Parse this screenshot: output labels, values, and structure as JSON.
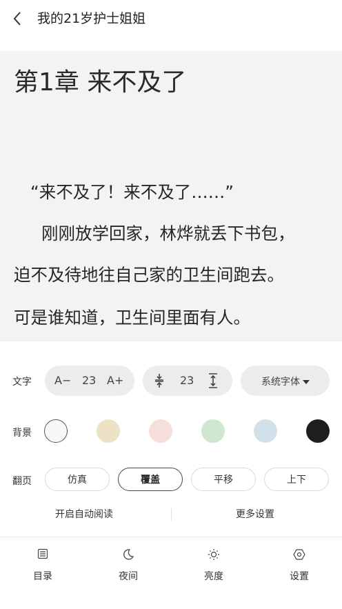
{
  "header": {
    "back_icon": "chevron-left-icon",
    "title": "我的21岁护士姐姐"
  },
  "reader": {
    "chapter_title": "第1章 来不及了",
    "paragraphs": [
      "“来不及了！来不及了……”",
      "刚刚放学回家，林烨就丢下书包，",
      "迫不及待地往自己家的卫生间跑去。",
      "可是谁知道，卫生间里面有人。"
    ]
  },
  "settings": {
    "text": {
      "label": "文字",
      "decrease": "A−",
      "font_size": "23",
      "increase": "A+",
      "line_spacing": "23",
      "font_family": "系统字体"
    },
    "background": {
      "label": "背景",
      "colors": [
        "#f7f7f9",
        "#ede1c6",
        "#f6dedb",
        "#cfe6cf",
        "#d2e1e9",
        "#1e1e1e"
      ],
      "selected": 0
    },
    "page_turn": {
      "label": "翻页",
      "options": [
        "仿真",
        "覆盖",
        "平移",
        "上下"
      ],
      "selected": "覆盖"
    },
    "auto_read": "开启自动阅读",
    "more_settings": "更多设置"
  },
  "bottom_nav": {
    "items": [
      {
        "label": "目录",
        "icon": "list-icon"
      },
      {
        "label": "夜间",
        "icon": "moon-icon"
      },
      {
        "label": "亮度",
        "icon": "sun-icon"
      },
      {
        "label": "设置",
        "icon": "settings-icon"
      }
    ]
  }
}
